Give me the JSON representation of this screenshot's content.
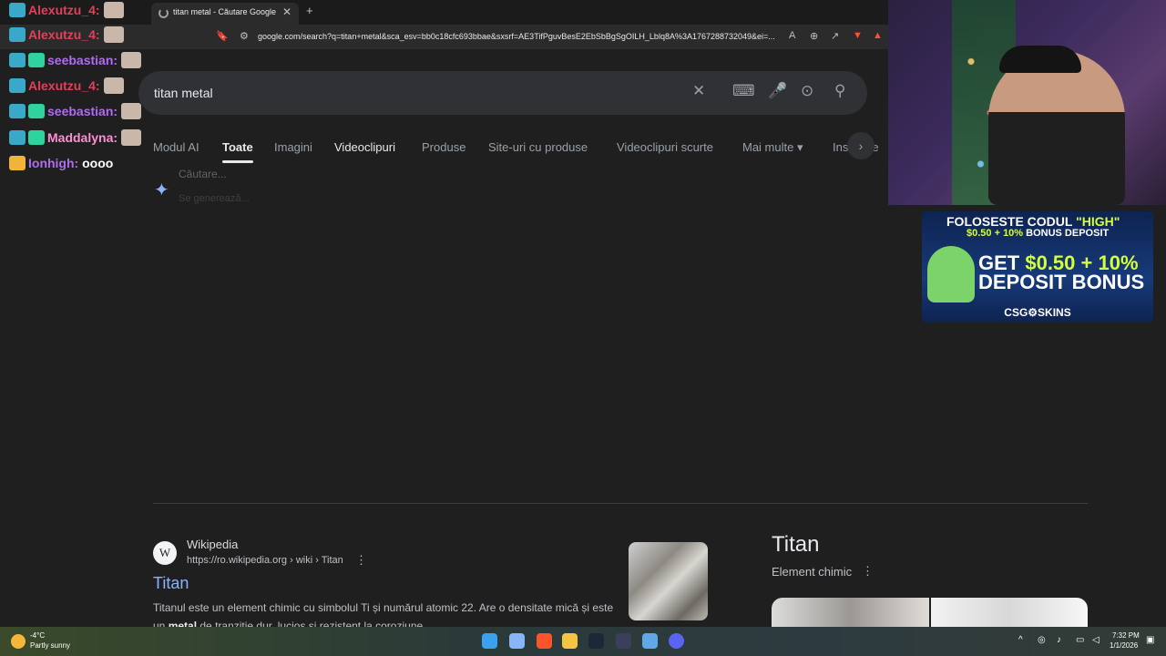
{
  "browser": {
    "tab_title": "titan metal - Căutare Google",
    "new_tab": "+",
    "tab_close": "✕",
    "url": "google.com/search?q=titan+metal&sca_esv=bb0c18cfc693bbae&sxsrf=AE3TifPguvBesE2EbSbBgSgOILH_Lblq8A%3A1767288732049&ei=..."
  },
  "search": {
    "query": "titan metal",
    "clear_icon": "✕",
    "keyboard_icon": "⌨",
    "mic_icon": "🎤",
    "lens_icon": "⊙",
    "search_icon": "⚲"
  },
  "nav": {
    "items": [
      "Modul AI",
      "Toate",
      "Imagini",
      "Videoclipuri",
      "Produse",
      "Site-uri cu produse",
      "Videoclipuri scurte",
      "Mai multe ▾",
      "Instrume"
    ],
    "scroll_icon": "›"
  },
  "ai_overview": {
    "line1": "Căutare...",
    "line2": "Se generează..."
  },
  "result": {
    "site": "Wikipedia",
    "logo": "W",
    "url": "https://ro.wikipedia.org › wiki › Titan",
    "more": "⋮",
    "title": "Titan",
    "snippet_pre": "Titanul este un element chimic cu simbolul Ti și numărul atomic 22. Are o densitate mică și este un ",
    "snippet_bold": "metal",
    "snippet_post": " de tranziție dur, lucios și rezistent la coroziune."
  },
  "knowledge_panel": {
    "title": "Titan",
    "subtitle": "Element chimic",
    "more": "⋮"
  },
  "chat": [
    {
      "user": "Alexutzu_4:",
      "color": "#e0405a",
      "msg": ""
    },
    {
      "user": "Alexutzu_4:",
      "color": "#e0405a",
      "msg": ""
    },
    {
      "user": "seebastian:",
      "color": "#b06cf0",
      "msg": ""
    },
    {
      "user": "Alexutzu_4:",
      "color": "#e0405a",
      "msg": ""
    },
    {
      "user": "seebastian:",
      "color": "#b06cf0",
      "msg": ""
    },
    {
      "user": "Maddalyna:",
      "color": "#ff8fd1",
      "msg": ""
    },
    {
      "user": "Ionhigh:",
      "color": "#b06cf0",
      "msg": "oooo"
    }
  ],
  "promo": {
    "line1_pre": "FOLOSESTE CODUL ",
    "line1_code": "\"HIGH\"",
    "line2_amount": "$0.50 + 10%",
    "line2_post": " BONUS DEPOSIT",
    "line3_pre": "GET ",
    "line3_amount": "$0.50 + 10%",
    "line4": "DEPOSIT BONUS",
    "brand": "CSG⚙SKINS"
  },
  "taskbar": {
    "temp": "-4°C",
    "weather": "Partly sunny",
    "time": "7:32 PM",
    "date": "1/1/2026"
  },
  "colors": {
    "background": "#1f1f1f",
    "link": "#8ab4f8",
    "accent_spark": "#8ab4f8"
  }
}
